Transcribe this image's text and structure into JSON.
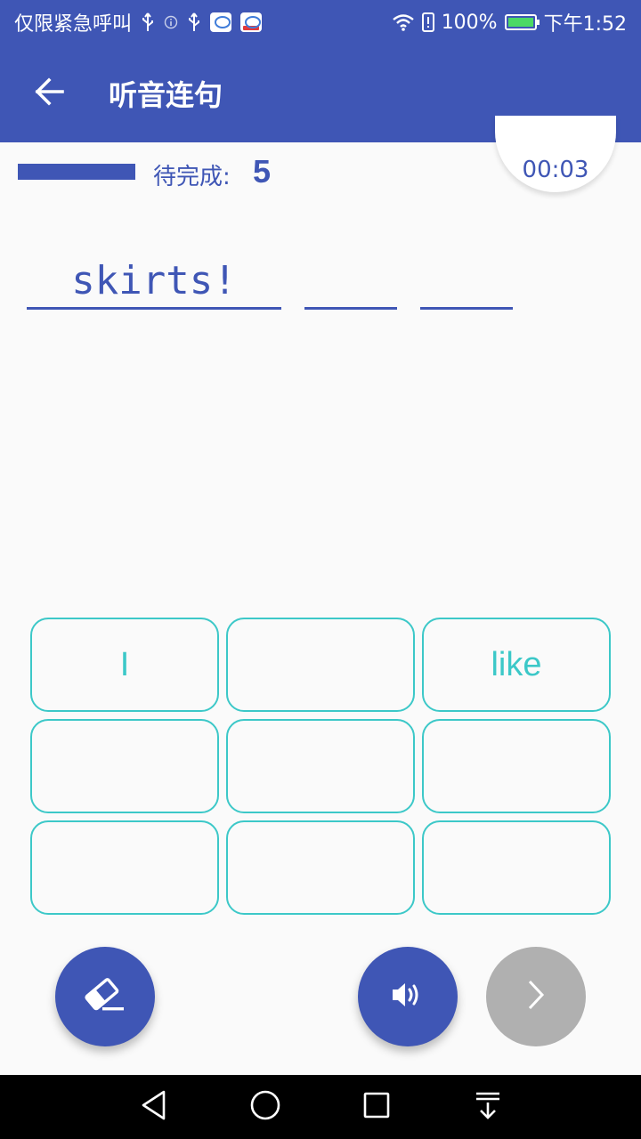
{
  "status_bar": {
    "carrier_text": "仅限紧急呼叫",
    "battery_percent": "100%",
    "time": "下午1:52"
  },
  "app_bar": {
    "title": "听音连句"
  },
  "progress": {
    "pending_label": "待完成:",
    "pending_count": "5",
    "fraction_filled": 1.0
  },
  "timer": {
    "value": "00:03"
  },
  "sentence": {
    "blanks": [
      "skirts!",
      "",
      ""
    ]
  },
  "word_options": [
    "I",
    "",
    "like",
    "",
    "",
    "",
    "",
    "",
    ""
  ],
  "colors": {
    "primary": "#3f56b5",
    "accent_teal": "#3cc8c8",
    "disabled_gray": "#b0b0b0",
    "background": "#fafafa"
  },
  "icons": {
    "back": "arrow-left-icon",
    "erase": "eraser-icon",
    "sound": "speaker-icon",
    "next": "chevron-right-icon"
  }
}
